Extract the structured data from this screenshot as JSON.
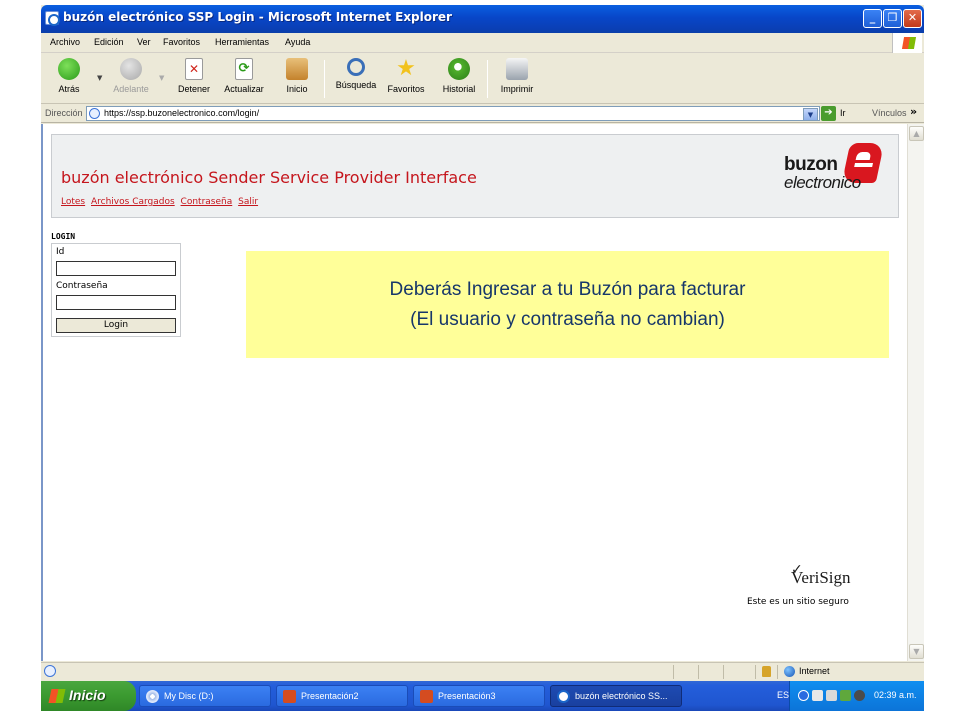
{
  "window": {
    "title": "buzón electrónico SSP Login - Microsoft Internet Explorer",
    "minimize_label": "_",
    "maximize_label": "❐",
    "close_label": "✕"
  },
  "menu": [
    "Archivo",
    "Edición",
    "Ver",
    "Favoritos",
    "Herramientas",
    "Ayuda"
  ],
  "toolbar": {
    "back": "Atrás",
    "forward": "Adelante",
    "stop": "Detener",
    "refresh": "Actualizar",
    "home": "Inicio",
    "search": "Búsqueda",
    "favorites": "Favoritos",
    "history": "Historial",
    "print": "Imprimir"
  },
  "address": {
    "label": "Dirección",
    "url": "https://ssp.buzonelectronico.com/login/",
    "go_label": "Ir",
    "links_label": "Vínculos",
    "more_label": "»"
  },
  "page": {
    "site_title": "buzón electrónico Sender Service Provider Interface",
    "nav": [
      "Lotes",
      "Archivos Cargados",
      "Contraseña",
      "Salir"
    ],
    "logo_line1": "buzon",
    "logo_line2": "electronico",
    "login_heading": "LOGIN",
    "id_label": "Id",
    "id_value": "",
    "password_label": "Contraseña",
    "password_value": "",
    "login_button": "Login",
    "note_line1": "Deberás Ingresar a tu Buzón para facturar",
    "note_line2": "(El usuario y contraseña no cambian)",
    "verisign_brand": "VeriSign",
    "verisign_caption": "Este es un sitio seguro"
  },
  "status": {
    "zone": "Internet"
  },
  "taskbar": {
    "start_label": "Inicio",
    "tasks": [
      "My Disc (D:)",
      "Presentación2",
      "Presentación3",
      "buzón electrónico SS..."
    ],
    "language": "ES",
    "clock": "02:39 a.m."
  },
  "colors": {
    "brand_red": "#c5161d",
    "note_background": "#ffff99",
    "note_text": "#17376a",
    "xp_blue": "#0846c8"
  }
}
